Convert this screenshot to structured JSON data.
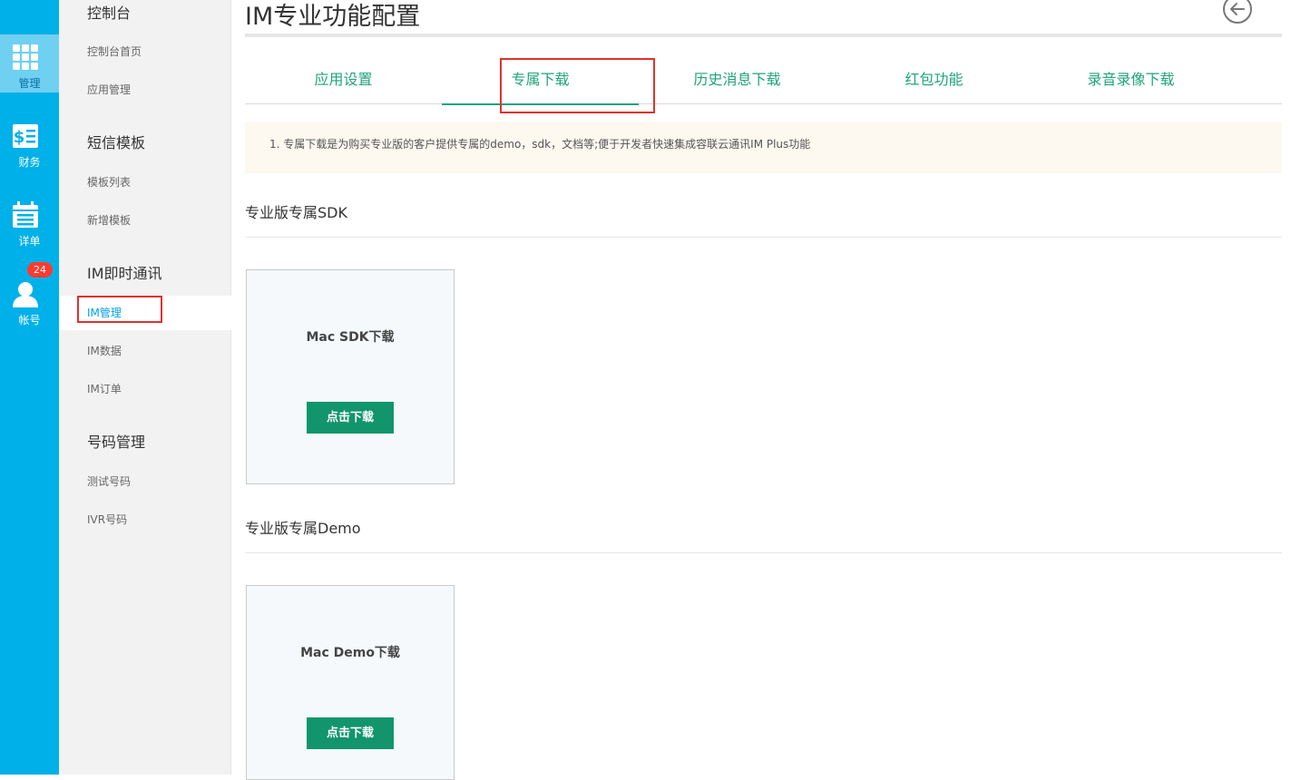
{
  "rail": {
    "items": [
      {
        "label": "管理",
        "icon": "grid-icon"
      },
      {
        "label": "财务",
        "icon": "finance-icon"
      },
      {
        "label": "详单",
        "icon": "calendar-icon"
      },
      {
        "label": "帐号",
        "icon": "user-icon",
        "badge": "24"
      }
    ]
  },
  "menu": {
    "groups": [
      {
        "title": "控制台",
        "items": [
          "控制台首页",
          "应用管理"
        ]
      },
      {
        "title": "短信模板",
        "items": [
          "模板列表",
          "新增模板"
        ]
      },
      {
        "title": "IM即时通讯",
        "items": [
          "IM管理",
          "IM数据",
          "IM订单"
        ]
      },
      {
        "title": "号码管理",
        "items": [
          "测试号码",
          "IVR号码"
        ]
      }
    ],
    "active_item": "IM管理"
  },
  "main": {
    "title": "IM专业功能配置",
    "tabs": [
      "应用设置",
      "专属下载",
      "历史消息下载",
      "红包功能",
      "录音录像下载"
    ],
    "active_tab": "专属下载",
    "notice": "1. 专属下载是为购买专业版的客户提供专属的demo，sdk，文档等;便于开发者快速集成容联云通讯IM Plus功能",
    "sections": [
      {
        "title": "专业版专属SDK",
        "card_title": "Mac SDK下载",
        "button": "点击下载"
      },
      {
        "title": "专业版专属Demo",
        "card_title": "Mac Demo下载",
        "button": "点击下载"
      }
    ]
  },
  "colors": {
    "rail_bg": "#00b0e8",
    "accent_green": "#1fa37a",
    "button_green": "#12956b",
    "highlight_red": "#e0322d",
    "badge_red": "#ff3b30"
  }
}
